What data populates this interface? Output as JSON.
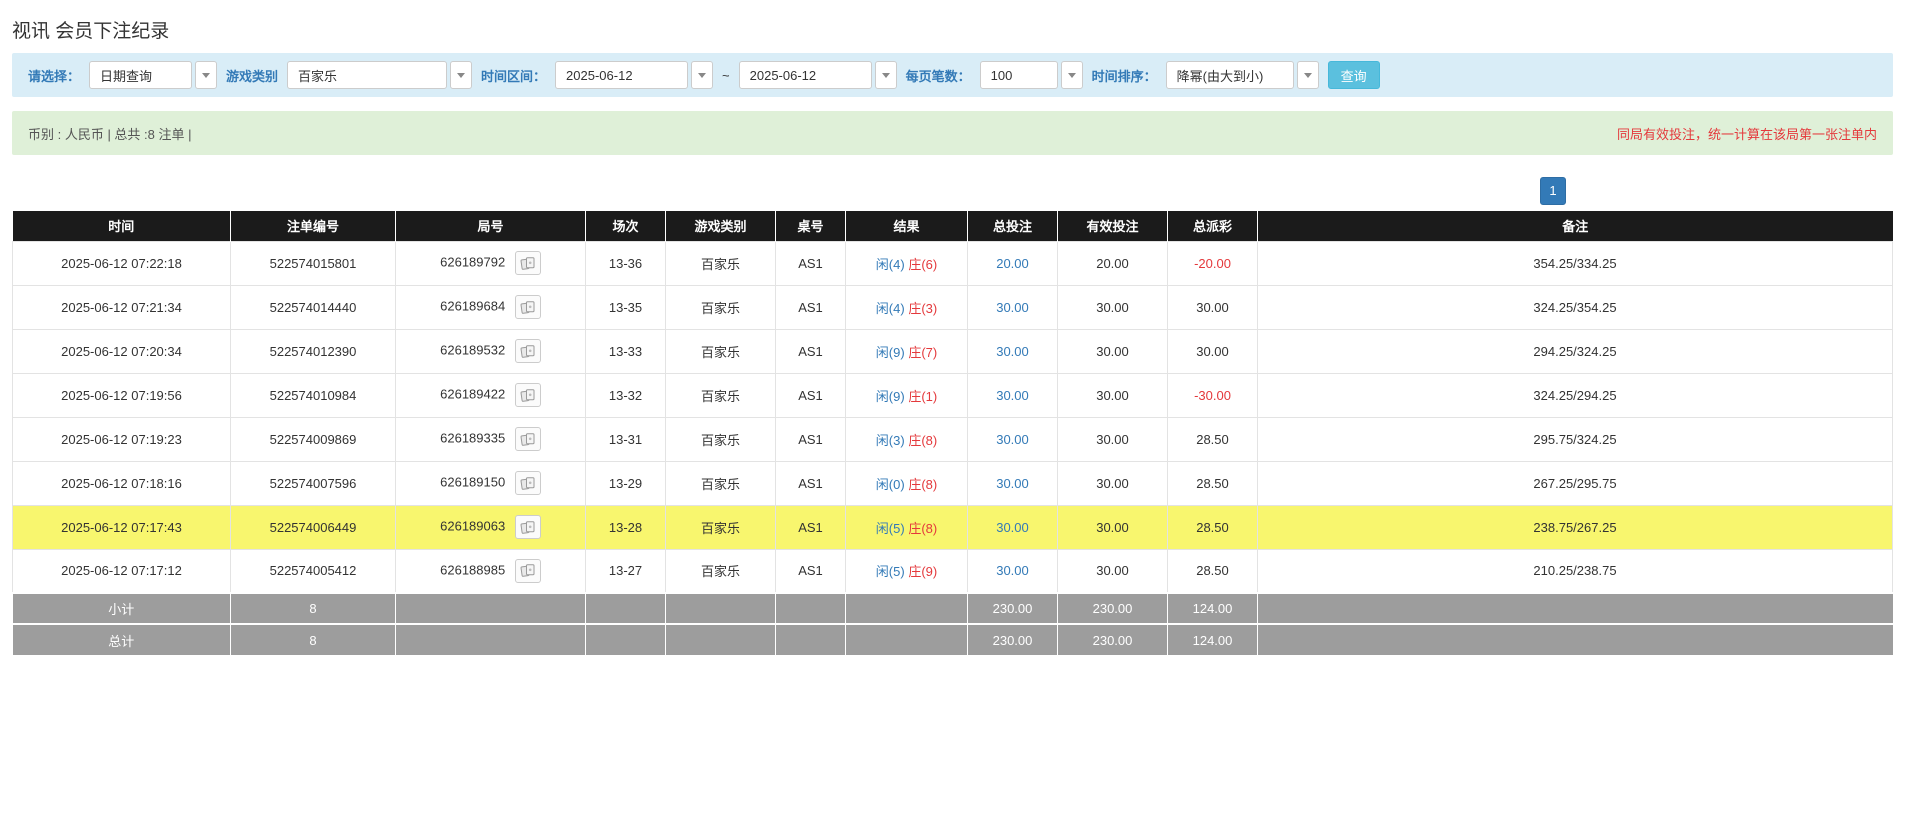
{
  "page": {
    "title": "视讯 会员下注纪录"
  },
  "colors": {
    "accent_blue": "#337ab7",
    "alert_red": "#e4393c",
    "button_cyan": "#5bc0de",
    "filter_bg": "#d9edf7",
    "summary_bg": "#dff0d8",
    "header_bg": "#1b1b1b",
    "footer_bg": "#9d9d9d",
    "highlight_yellow": "#f8f66e"
  },
  "filter": {
    "select_label": "请选择：",
    "select_value": "日期查询",
    "game_label": "游戏类别",
    "game_value": "百家乐",
    "range_label": "时间区间：",
    "date_from": "2025-06-12",
    "range_separator": "~",
    "date_to": "2025-06-12",
    "per_page_label": "每页笔数：",
    "per_page_value": "100",
    "sort_label": "时间排序：",
    "sort_value": "降幂(由大到小)",
    "search_button_label": "查询"
  },
  "summary_bar": {
    "currency_info": "币别 : 人民币 | 总共 :8 注单 |",
    "notice": "同局有效投注，统一计算在该局第一张注单内"
  },
  "pagination": {
    "current_page": "1"
  },
  "table": {
    "headers": [
      "时间",
      "注单编号",
      "局号",
      "场次",
      "游戏类别",
      "桌号",
      "结果",
      "总投注",
      "有效投注",
      "总派彩",
      "备注"
    ],
    "rows": [
      {
        "time": "2025-06-12 07:22:18",
        "bet_id": "522574015801",
        "round_id": "626189792",
        "session": "13-36",
        "game": "百家乐",
        "table_no": "AS1",
        "result_player": "闲(4)",
        "result_banker": "庄(6)",
        "total_bet": "20.00",
        "valid_bet": "20.00",
        "payout": "-20.00",
        "remark": "354.25/334.25",
        "highlighted": false
      },
      {
        "time": "2025-06-12 07:21:34",
        "bet_id": "522574014440",
        "round_id": "626189684",
        "session": "13-35",
        "game": "百家乐",
        "table_no": "AS1",
        "result_player": "闲(4)",
        "result_banker": "庄(3)",
        "total_bet": "30.00",
        "valid_bet": "30.00",
        "payout": "30.00",
        "remark": "324.25/354.25",
        "highlighted": false
      },
      {
        "time": "2025-06-12 07:20:34",
        "bet_id": "522574012390",
        "round_id": "626189532",
        "session": "13-33",
        "game": "百家乐",
        "table_no": "AS1",
        "result_player": "闲(9)",
        "result_banker": "庄(7)",
        "total_bet": "30.00",
        "valid_bet": "30.00",
        "payout": "30.00",
        "remark": "294.25/324.25",
        "highlighted": false
      },
      {
        "time": "2025-06-12 07:19:56",
        "bet_id": "522574010984",
        "round_id": "626189422",
        "session": "13-32",
        "game": "百家乐",
        "table_no": "AS1",
        "result_player": "闲(9)",
        "result_banker": "庄(1)",
        "total_bet": "30.00",
        "valid_bet": "30.00",
        "payout": "-30.00",
        "remark": "324.25/294.25",
        "highlighted": false
      },
      {
        "time": "2025-06-12 07:19:23",
        "bet_id": "522574009869",
        "round_id": "626189335",
        "session": "13-31",
        "game": "百家乐",
        "table_no": "AS1",
        "result_player": "闲(3)",
        "result_banker": "庄(8)",
        "total_bet": "30.00",
        "valid_bet": "30.00",
        "payout": "28.50",
        "remark": "295.75/324.25",
        "highlighted": false
      },
      {
        "time": "2025-06-12 07:18:16",
        "bet_id": "522574007596",
        "round_id": "626189150",
        "session": "13-29",
        "game": "百家乐",
        "table_no": "AS1",
        "result_player": "闲(0)",
        "result_banker": "庄(8)",
        "total_bet": "30.00",
        "valid_bet": "30.00",
        "payout": "28.50",
        "remark": "267.25/295.75",
        "highlighted": false
      },
      {
        "time": "2025-06-12 07:17:43",
        "bet_id": "522574006449",
        "round_id": "626189063",
        "session": "13-28",
        "game": "百家乐",
        "table_no": "AS1",
        "result_player": "闲(5)",
        "result_banker": "庄(8)",
        "total_bet": "30.00",
        "valid_bet": "30.00",
        "payout": "28.50",
        "remark": "238.75/267.25",
        "highlighted": true
      },
      {
        "time": "2025-06-12 07:17:12",
        "bet_id": "522574005412",
        "round_id": "626188985",
        "session": "13-27",
        "game": "百家乐",
        "table_no": "AS1",
        "result_player": "闲(5)",
        "result_banker": "庄(9)",
        "total_bet": "30.00",
        "valid_bet": "30.00",
        "payout": "28.50",
        "remark": "210.25/238.75",
        "highlighted": false
      }
    ],
    "subtotal": {
      "label": "小计",
      "count": "8",
      "total_bet": "230.00",
      "valid_bet": "230.00",
      "payout": "124.00"
    },
    "grand_total": {
      "label": "总计",
      "count": "8",
      "total_bet": "230.00",
      "valid_bet": "230.00",
      "payout": "124.00"
    }
  }
}
